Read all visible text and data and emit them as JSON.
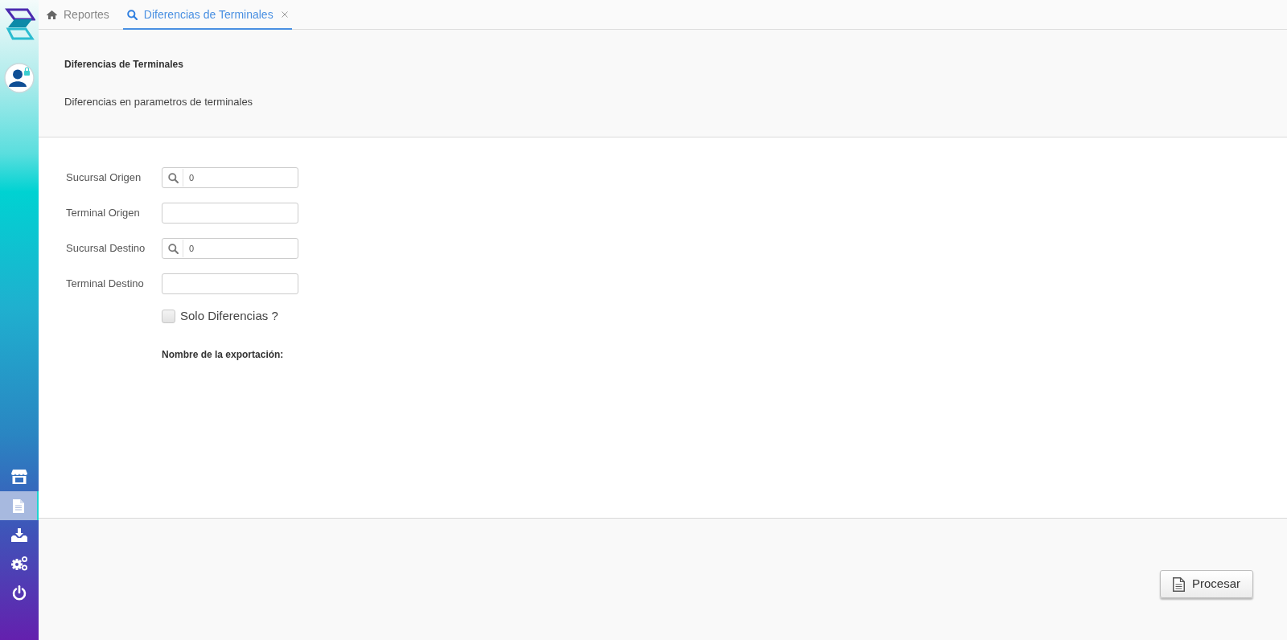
{
  "sidebar": {
    "items": [
      {
        "kind": "store",
        "selected": false
      },
      {
        "kind": "document",
        "selected": true
      },
      {
        "kind": "download",
        "selected": false
      },
      {
        "kind": "settings",
        "selected": false
      },
      {
        "kind": "power",
        "selected": false
      }
    ]
  },
  "tabs": [
    {
      "kind": "home",
      "label": "Reportes",
      "selected": false,
      "closable": false
    },
    {
      "kind": "search",
      "label": "Diferencias de Terminales",
      "selected": true,
      "closable": true
    }
  ],
  "header": {
    "title": "Diferencias de Terminales",
    "description": "Diferencias en parametros de terminales"
  },
  "form": {
    "fields": [
      {
        "kind": "lookup",
        "label": "Sucursal Origen",
        "value": "0"
      },
      {
        "kind": "text",
        "label": "Terminal Origen"
      },
      {
        "kind": "lookup",
        "label": "Sucursal Destino",
        "value": "0"
      },
      {
        "kind": "text",
        "label": "Terminal Destino"
      }
    ],
    "checkbox": {
      "label": "Solo Diferencias ?",
      "checked": false
    },
    "export_name_label": "Nombre de la exportación:"
  },
  "footer": {
    "buttons": [
      {
        "label": "Procesar"
      }
    ]
  }
}
